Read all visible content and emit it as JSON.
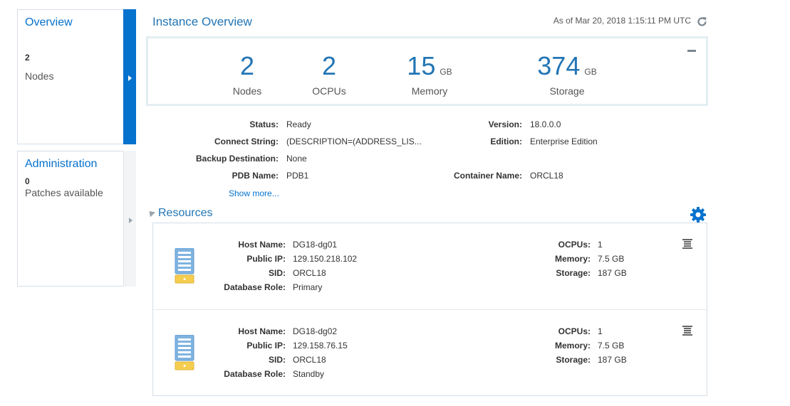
{
  "left_tiles": {
    "overview": {
      "title": "Overview",
      "count": "2",
      "subtitle": "Nodes"
    },
    "administration": {
      "title": "Administration",
      "count": "0",
      "subtitle": "Patches available"
    }
  },
  "header": {
    "title": "Instance Overview",
    "as_of": "As of Mar 20, 2018 1:15:11 PM UTC"
  },
  "summary": {
    "nodes": {
      "value": "2",
      "label": "Nodes"
    },
    "ocpus": {
      "value": "2",
      "label": "OCPUs"
    },
    "memory": {
      "value": "15",
      "unit": "GB",
      "label": "Memory"
    },
    "storage": {
      "value": "374",
      "unit": "GB",
      "label": "Storage"
    }
  },
  "details": {
    "status_label": "Status:",
    "status": "Ready",
    "connect_label": "Connect String:",
    "connect": "(DESCRIPTION=(ADDRESS_LIS...",
    "backup_label": "Backup Destination:",
    "backup": "None",
    "pdb_label": "PDB Name:",
    "pdb": "PDB1",
    "version_label": "Version:",
    "version": "18.0.0.0",
    "edition_label": "Edition:",
    "edition": "Enterprise Edition",
    "container_label": "Container Name:",
    "container": "ORCL18",
    "show_more": "Show more..."
  },
  "resources": {
    "title": "Resources",
    "labels": {
      "host": "Host Name:",
      "ip": "Public IP:",
      "sid": "SID:",
      "role": "Database Role:",
      "ocpus": "OCPUs:",
      "memory": "Memory:",
      "storage": "Storage:"
    },
    "hosts": [
      {
        "host": "DG18-dg01",
        "ip": "129.150.218.102",
        "sid": "ORCL18",
        "role": "Primary",
        "ocpus": "1",
        "memory": "7.5 GB",
        "storage": "187 GB"
      },
      {
        "host": "DG18-dg02",
        "ip": "129.158.76.15",
        "sid": "ORCL18",
        "role": "Standby",
        "ocpus": "1",
        "memory": "7.5 GB",
        "storage": "187 GB"
      }
    ]
  },
  "colors": {
    "accent": "#0572ce",
    "title_blue": "#2275b5",
    "server_blue": "#7fb3e0",
    "server_yellow": "#f5cd4e"
  }
}
